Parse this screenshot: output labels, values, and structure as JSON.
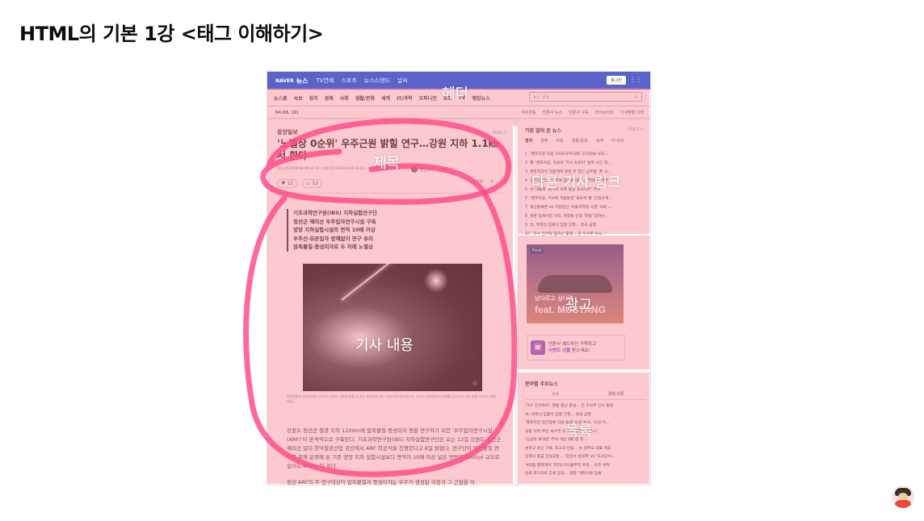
{
  "slide": {
    "title": "HTML의 기본 1강 <태그 이해하기>"
  },
  "naver": {
    "logo": "NAVER",
    "section": "뉴스",
    "top_nav": [
      "TV연예",
      "스포츠",
      "뉴스스탠드",
      "날씨"
    ],
    "login": "로그인",
    "menu": [
      "뉴스홈",
      "속보",
      "정치",
      "경제",
      "사회",
      "생활/문화",
      "세계",
      "IT/과학",
      "오피니언",
      "포토",
      "TV",
      "랭킹뉴스"
    ],
    "search_placeholder": "뉴스 검색",
    "date": "04.08. (토)",
    "sub_links": [
      "언론사 뉴스",
      "언론사 구독",
      "라이브러리",
      "기사배열 이력"
    ],
    "sub_first": "억조원등"
  },
  "article": {
    "press": "중앙일보",
    "press_right": "PICK ⓘ",
    "headline": "'노벨상 0순위' 우주근원 밝힐 연구…강원 지하 1.1㎞서 한다",
    "meta": "기사입력 2018-04-08 16:14 | 최종수정 2018-04-08 16:51 | 기사원문 | 스크랩",
    "reporter": "본문듣기 · 설정",
    "reaction_like": "12",
    "reaction_comment": "52",
    "tools": [
      "요약봇",
      "가",
      "공유"
    ],
    "summary": [
      "기초과학연구원(IBS) 지하실험연구단",
      "정선군 예미산 우주입자연구시설 구축",
      "양양 지하실험시설의 면적 10배 이상",
      "우주선·뮤온입자 방해없이 연구 유리",
      "암흑물질·중성미자로 두 차례 노벨상"
    ],
    "caption": "암흑물질과 중성미자는 우주의 구성과 기원을 밝힐 수 있는 매력적인 연구 대상으로 평가받는다. 사진은 암흑물질의 존재를 연구하기 위한 실험 이미지. [IBS 제공]",
    "body": "강원도 정선군 철광 지하 1100m에 암흑물질·중성미자 등을 연구하기 위한 '우주입자연구시설(ARF)'이 본격적으로 구축된다. 기초과학연구원(IBS) 지하실험연구단은 오는 12일 강원도 정선군 예미산 일대 한덕철광산업 광산에서 ARF 착공식을 진행한다고 8일 밝혔다. 연구단이 암흑물질 연구를 위해 운영해 온 기존 양양 지하 실험시설보다 면적이 10배 이상 넓은 연면적 2000㎡ 규모로 깊이도 400m 더 깊다.",
    "body_more": "정선 ARF의 주 연구대상이 암흑물질과 중성미자는 우주가 생성된 과정과 그 근원을 이"
  },
  "sidebar": {
    "heading": "가장 많이 본 뉴스",
    "more": "더보기 >",
    "tabs": [
      "정치",
      "경제",
      "사회",
      "생활/문화",
      "세계",
      "IT/과학"
    ],
    "items": [
      "'경호처장 직원 가시도우미사퇴' 조선일보 보도...",
      "靑 '경호처장, 직원의 '가시 도우미' 업무 시킨 적...",
      "경호처장이 직원에게 탈원 위 집인 심부름' 靑 사...",
      "김기식 원장 측 의혹 갈수록 태산… 청와대 '해명'",
      "文 대통령 '김기식 의혹 동정 조사하라' 지시",
      "'경호처장, 가사에 직원동원' 보도에 靑 '인정수색...",
      "재산등록론 vs 가정집안 '서울지하철 낙찰' 극복 ...",
      "출판 입에서만 사죄, 재정을 인정 '할법' 입하는...",
      "文, 박영선·임종석 입항 강행... 청국 급행",
      "'가수 전서락 업하신 중영... 전 수사부 이시...'"
    ]
  },
  "ad": {
    "brand": "Ford",
    "tagline": "남다르고 싶다면",
    "feat": "feat. MUSTANG"
  },
  "promo": {
    "line1": "언론사 헤드라인 구독하고",
    "line2_highlight": "이벤트 선물",
    "line2_rest": "받으세요!",
    "icon": "gift-icon"
  },
  "sidebar2": {
    "heading": "분야별 주요뉴스",
    "tabs": [
      "시사",
      "경제/생활"
    ],
    "items": [
      "'가수 전서락씨', 탈법 출신 증설... 전 수사부 인사 통칭",
      "文, 박영선·임종석 입항 강행... 청국 급행",
      "'경호처장 집안일에 직원 동원' 논란 수사, '사실 이...",
      "공항 지역 주민 새수면 의 통해 현장 방문(+)",
      "'심상대 로대감' 무대 세빈 3배 증 첫...",
      "손학규 트인 기록, 최고의 반응... 뉴 정부도 대표 제휴",
      "김학의 출금 진실공방... '대검서 반대해' vs '조사단이...",
      "'4대험 병역해야' 50대 아이들부터 주축... 모두 우려",
      "빈축 마이코트 후세 입국... 경찰 '개천서로 입술'"
    ]
  },
  "overlay_labels": {
    "header": "헤더",
    "title": "제목",
    "related_links": "다른 기사 링크",
    "content": "기사 내용",
    "ad": "광고",
    "list": "목록"
  },
  "colors": {
    "overlay": "#f8788c",
    "naver_bar": "#5a63c9",
    "marker": "#ff4f8a"
  }
}
